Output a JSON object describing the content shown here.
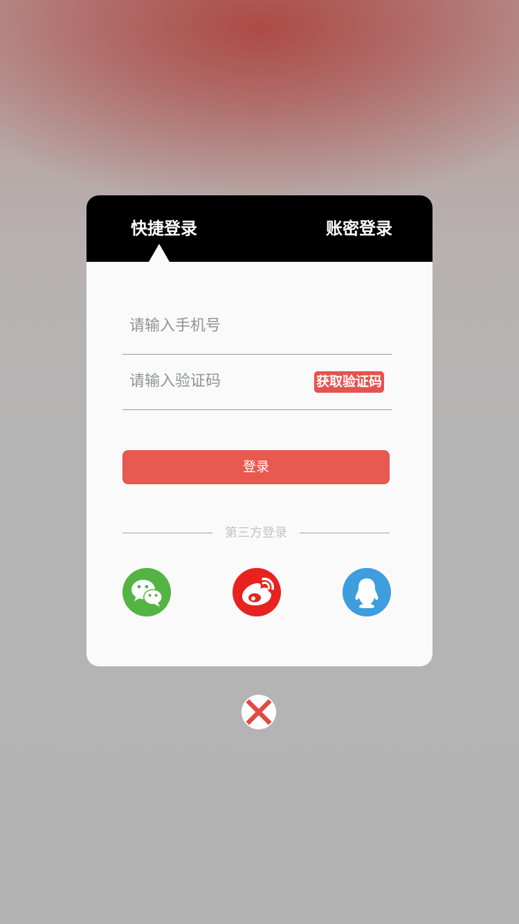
{
  "tabs": {
    "quick_login": "快捷登录",
    "password_login": "账密登录"
  },
  "form": {
    "phone_placeholder": "请输入手机号",
    "code_placeholder": "请输入验证码",
    "get_code_label": "获取验证码",
    "login_label": "登录"
  },
  "third_party": {
    "label": "第三方登录",
    "providers": [
      {
        "icon": "wechat-icon",
        "color": "#53b443"
      },
      {
        "icon": "weibo-icon",
        "color": "#e8231f"
      },
      {
        "icon": "qq-icon",
        "color": "#3e9ddc"
      }
    ]
  },
  "close_icon": "close-icon",
  "colors": {
    "accent": "#e85a50",
    "tab_bar": "#000000",
    "card": "#fafafa"
  }
}
